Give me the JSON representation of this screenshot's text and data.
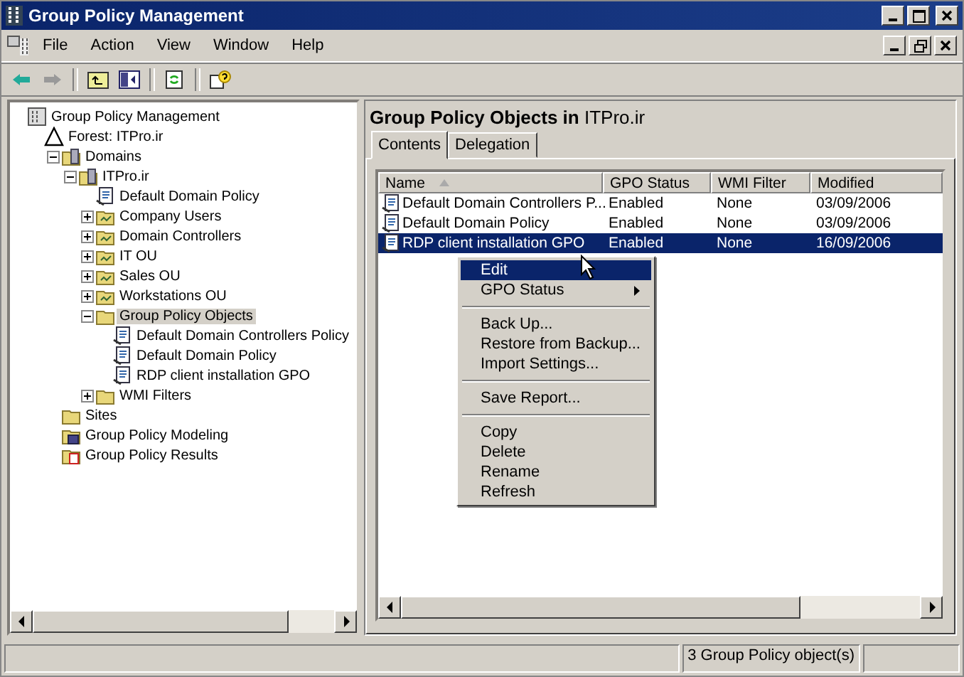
{
  "window": {
    "title": "Group Policy Management"
  },
  "menu": [
    "File",
    "Action",
    "View",
    "Window",
    "Help"
  ],
  "tree": [
    {
      "label": "Group Policy Management",
      "kind": "console",
      "selected": false,
      "children": [
        {
          "label": "Forest: ITPro.ir",
          "kind": "forest",
          "selected": false,
          "children": [
            {
              "label": "Domains",
              "kind": "domains",
              "expanded": true,
              "selected": false,
              "children": [
                {
                  "label": "ITPro.ir",
                  "kind": "domain",
                  "expanded": true,
                  "selected": false,
                  "children": [
                    {
                      "label": "Default Domain Policy",
                      "kind": "gpo",
                      "selected": false
                    },
                    {
                      "label": "Company Users",
                      "kind": "ou",
                      "expanded": false,
                      "selected": false
                    },
                    {
                      "label": "Domain Controllers",
                      "kind": "ou",
                      "expanded": false,
                      "selected": false
                    },
                    {
                      "label": "IT OU",
                      "kind": "ou",
                      "expanded": false,
                      "selected": false
                    },
                    {
                      "label": "Sales OU",
                      "kind": "ou",
                      "expanded": false,
                      "selected": false
                    },
                    {
                      "label": "Workstations OU",
                      "kind": "ou",
                      "expanded": false,
                      "selected": false
                    },
                    {
                      "label": "Group Policy Objects",
                      "kind": "folder",
                      "expanded": true,
                      "selected": true,
                      "children": [
                        {
                          "label": "Default Domain Controllers Policy",
                          "kind": "gpo",
                          "selected": false
                        },
                        {
                          "label": "Default Domain Policy",
                          "kind": "gpo",
                          "selected": false
                        },
                        {
                          "label": "RDP client installation GPO",
                          "kind": "gpo",
                          "selected": false
                        }
                      ]
                    },
                    {
                      "label": "WMI Filters",
                      "kind": "folder",
                      "expanded": false,
                      "selected": false
                    }
                  ]
                }
              ]
            },
            {
              "label": "Sites",
              "kind": "folder",
              "selected": false
            },
            {
              "label": "Group Policy Modeling",
              "kind": "modeling",
              "selected": false
            },
            {
              "label": "Group Policy Results",
              "kind": "results",
              "selected": false
            }
          ]
        }
      ]
    }
  ],
  "pane": {
    "heading": "**Group Policy Objects in** ITPro.ir",
    "tabs": [
      {
        "label": "Contents",
        "selected": true
      },
      {
        "label": "Delegation",
        "selected": false
      }
    ],
    "columns": [
      "Name",
      "GPO Status",
      "WMI Filter",
      "Modified"
    ],
    "rows": [
      {
        "name": "Default Domain Controllers P...",
        "status": "Enabled",
        "wmi": "None",
        "modified": "03/09/2006",
        "selected": false
      },
      {
        "name": "Default Domain Policy",
        "status": "Enabled",
        "wmi": "None",
        "modified": "03/09/2006",
        "selected": false
      },
      {
        "name": "RDP client installation GPO",
        "status": "Enabled",
        "wmi": "None",
        "modified": "16/09/2006",
        "selected": true
      }
    ]
  },
  "context_menu": [
    {
      "kind": "item",
      "label": "Edit",
      "selected": true
    },
    {
      "kind": "submenu",
      "label": "GPO Status",
      "selected": false
    },
    {
      "kind": "separator"
    },
    {
      "kind": "item",
      "label": "Back Up...",
      "selected": false
    },
    {
      "kind": "item",
      "label": "Restore from Backup...",
      "selected": false
    },
    {
      "kind": "item",
      "label": "Import Settings...",
      "selected": false
    },
    {
      "kind": "separator"
    },
    {
      "kind": "item",
      "label": "Save Report...",
      "selected": false
    },
    {
      "kind": "separator"
    },
    {
      "kind": "item",
      "label": "Copy",
      "selected": false
    },
    {
      "kind": "item",
      "label": "Delete",
      "selected": false
    },
    {
      "kind": "item",
      "label": "Rename",
      "selected": false
    },
    {
      "kind": "item",
      "label": "Refresh",
      "selected": false
    }
  ],
  "status_bar": "3 Group Policy object(s)"
}
